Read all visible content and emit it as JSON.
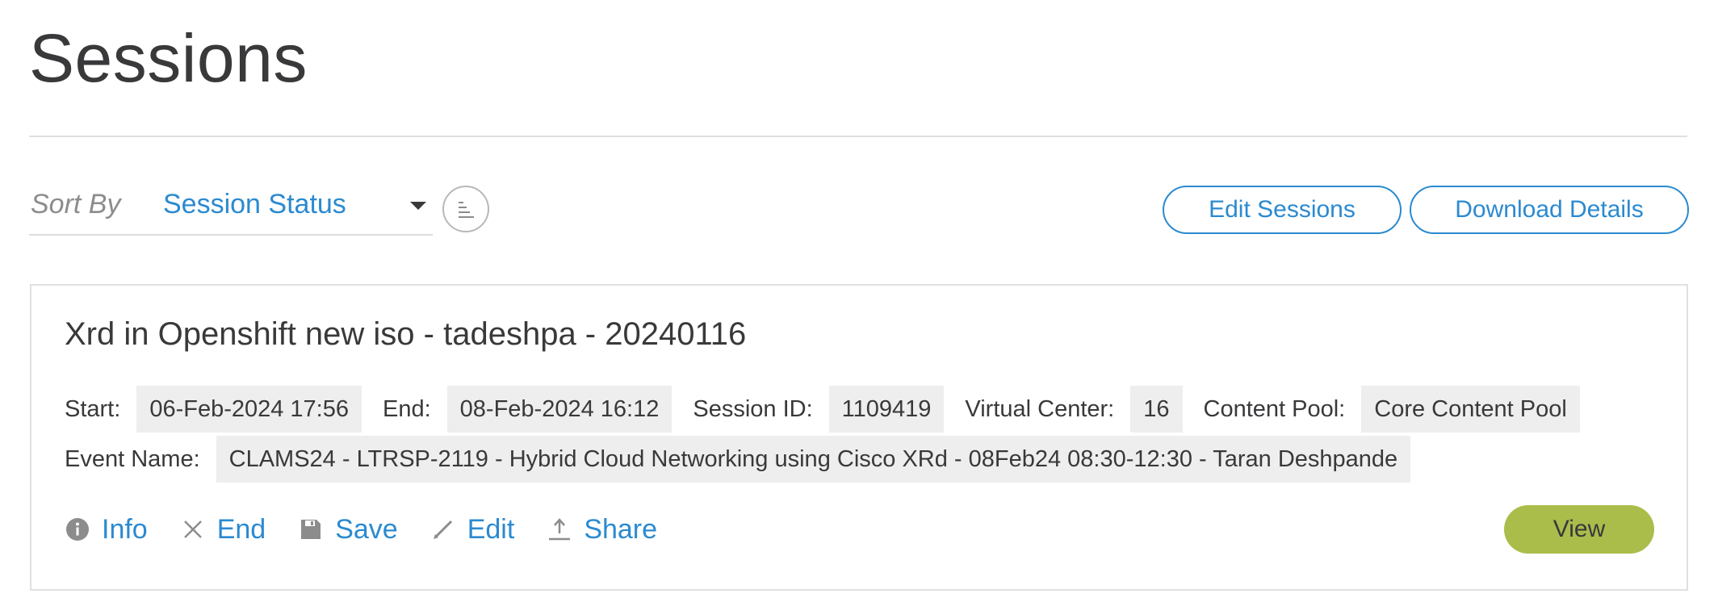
{
  "page": {
    "title": "Sessions"
  },
  "sort": {
    "label": "Sort By",
    "selected": "Session Status"
  },
  "toolbar": {
    "edit_sessions_label": "Edit Sessions",
    "download_details_label": "Download Details"
  },
  "session": {
    "title": "Xrd in Openshift new iso - tadeshpa - 20240116",
    "start_label": "Start:",
    "start_value": "06-Feb-2024 17:56",
    "end_label": "End:",
    "end_value": "08-Feb-2024 16:12",
    "session_id_label": "Session ID:",
    "session_id_value": "1109419",
    "virtual_center_label": "Virtual Center:",
    "virtual_center_value": "16",
    "content_pool_label": "Content Pool:",
    "content_pool_value": "Core Content Pool",
    "event_name_label": "Event Name:",
    "event_name_value": "CLAMS24 - LTRSP-2119 - Hybrid Cloud Networking using Cisco XRd - 08Feb24 08:30-12:30 - Taran Deshpande",
    "actions": {
      "info": "Info",
      "end": "End",
      "save": "Save",
      "edit": "Edit",
      "share": "Share"
    },
    "view_label": "View"
  },
  "colors": {
    "accent": "#2b8ad0",
    "view_button": "#aabd4b",
    "value_bg": "#eeeeee",
    "text": "#39393b"
  },
  "icons": {
    "sort_order": "sort-order-icon",
    "info": "info-icon",
    "end": "close-icon",
    "save": "save-icon",
    "edit": "pencil-icon",
    "share": "upload-icon",
    "dropdown": "chevron-down-icon"
  }
}
